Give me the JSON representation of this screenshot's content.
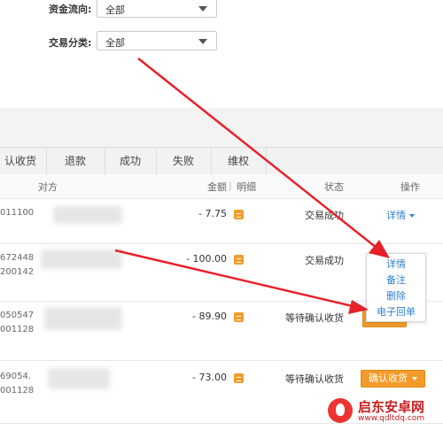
{
  "filters": {
    "direction": {
      "label": "资金流向:",
      "value": "全部"
    },
    "category": {
      "label": "交易分类:",
      "value": "全部"
    }
  },
  "tabs": [
    "认收货",
    "退款",
    "成功",
    "失败",
    "维权"
  ],
  "table_header": {
    "counterparty": "对方",
    "amount": "金额",
    "detail": "明细",
    "status": "状态",
    "action": "操作"
  },
  "rows": [
    {
      "acct1": "011100",
      "acct2": "",
      "amount": "- 7.75",
      "status": "交易成功",
      "action": "详情"
    },
    {
      "acct1": "672448",
      "acct2": "200142",
      "amount": "- 100.00",
      "status": "交易成功",
      "action": ""
    },
    {
      "acct1": "050547",
      "acct2": "001128",
      "amount": "- 89.90",
      "status": "等待确认收货",
      "action": ""
    },
    {
      "acct1": "69054.",
      "acct2": "001128",
      "amount": "- 73.00",
      "status": "等待确认收货",
      "action": "确认收货"
    }
  ],
  "menu": [
    "详情",
    "备注",
    "删除",
    "电子回单"
  ],
  "watermark": {
    "title": "启东安卓网",
    "url": "www.qdltdq.com"
  },
  "colors": {
    "accent": "#f39b2a",
    "link": "#2f7fcf",
    "arrow": "#e8202a"
  },
  "icons": {
    "dropdown": "chevron-down-icon",
    "detail": "detail-icon"
  }
}
